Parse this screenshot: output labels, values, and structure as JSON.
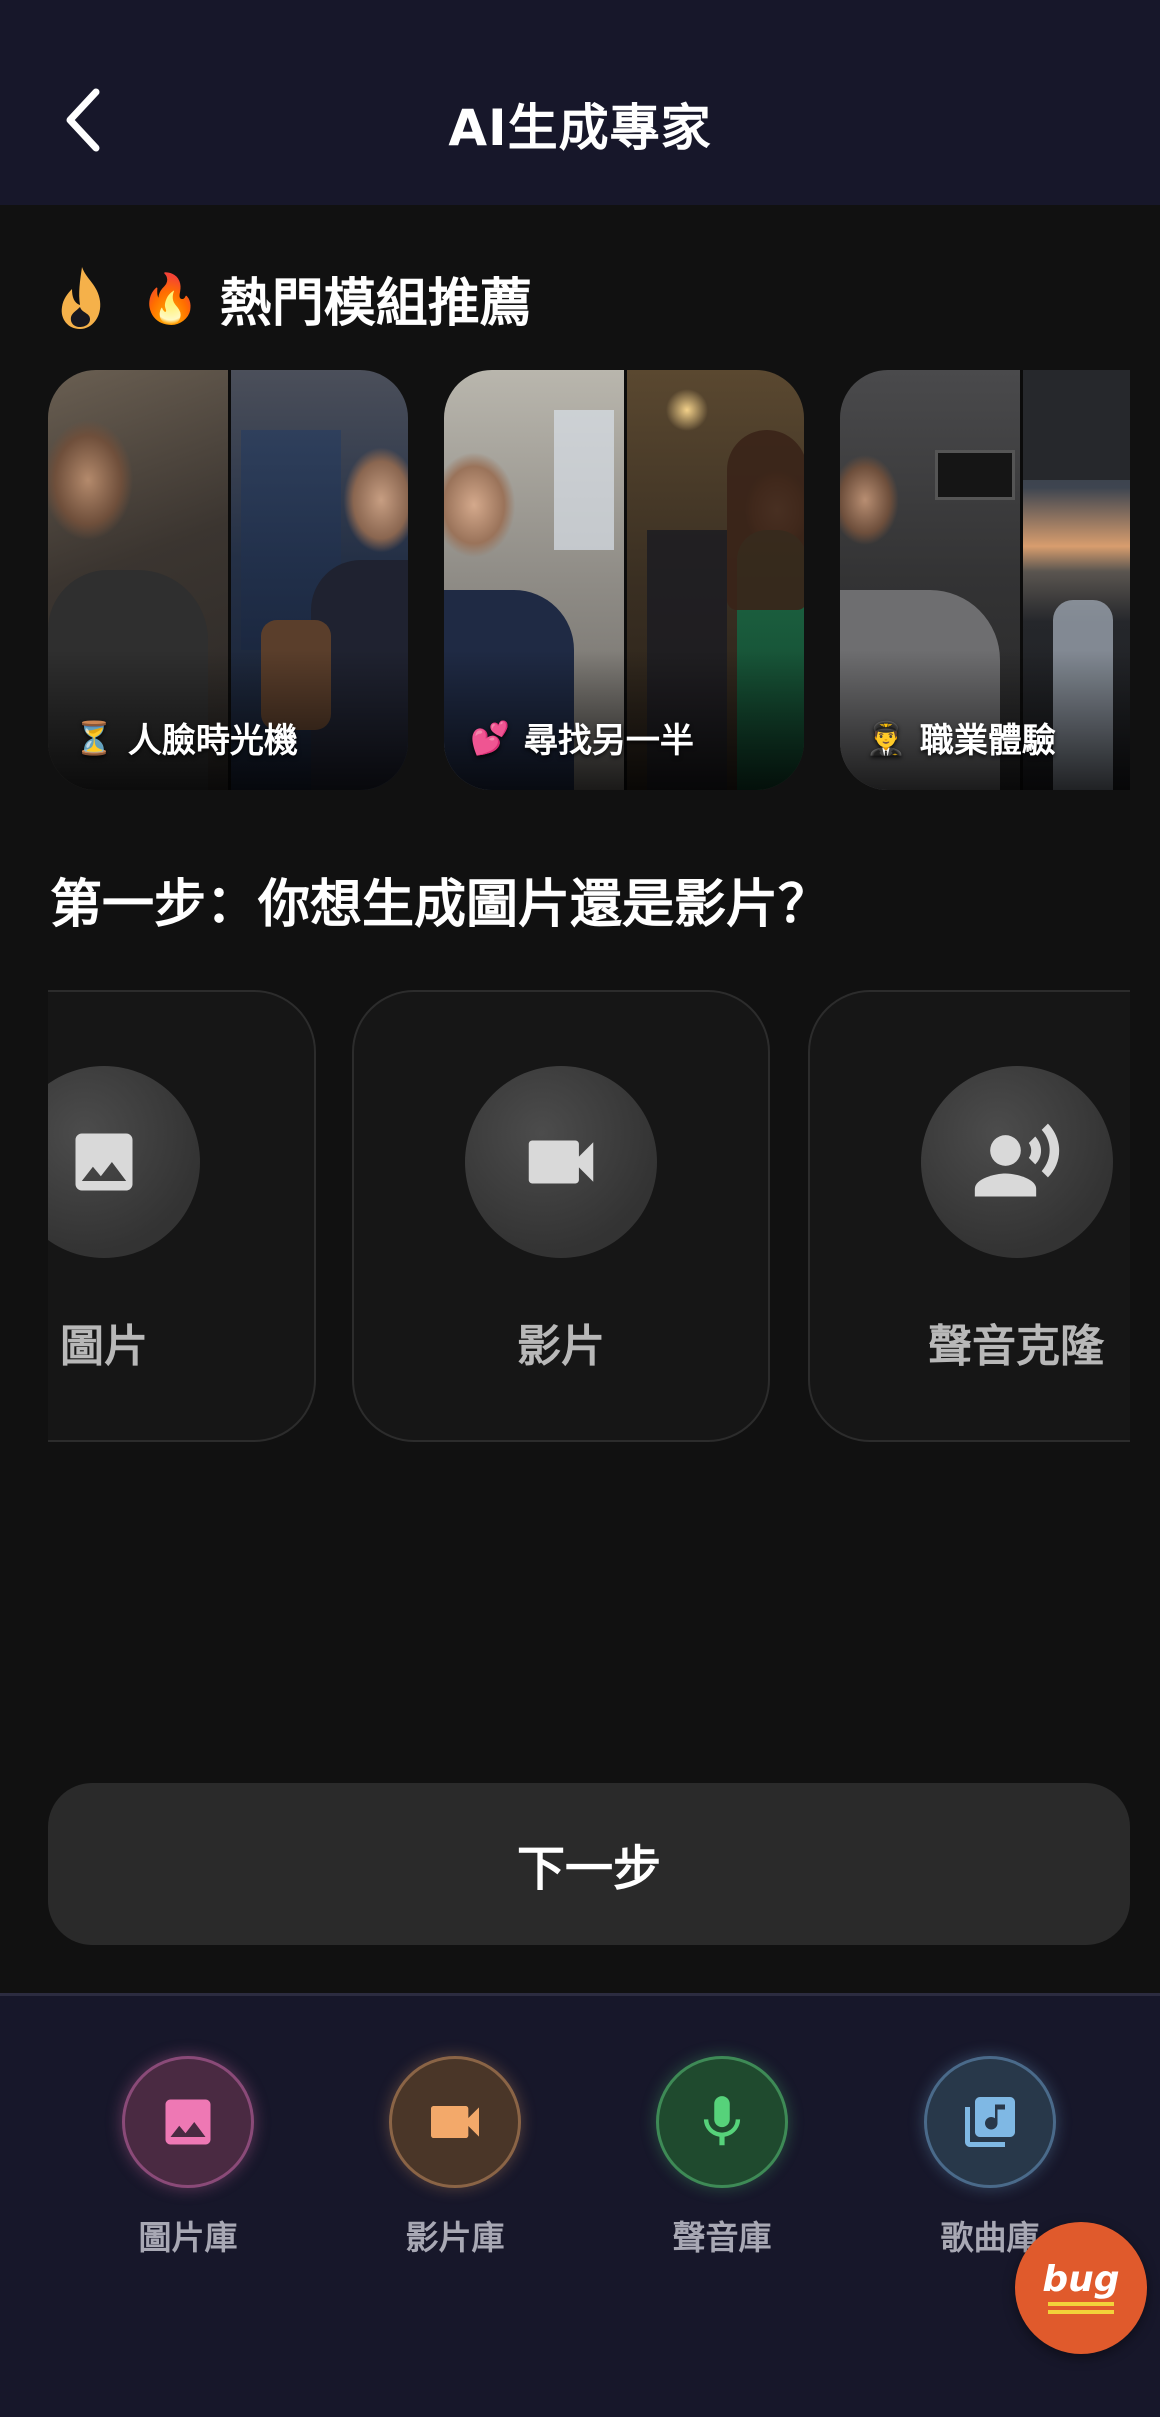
{
  "header": {
    "title": "AI生成專家"
  },
  "hot": {
    "emoji": "🔥",
    "title": "熱門模組推薦",
    "cards": [
      {
        "emoji": "⏳",
        "label": "人臉時光機"
      },
      {
        "emoji": "💕",
        "label": "尋找另一半"
      },
      {
        "emoji": "👨‍✈️",
        "label": "職業體驗"
      }
    ]
  },
  "step": {
    "title": "第一步：你想生成圖片還是影片？",
    "options": [
      {
        "label": "圖片",
        "icon": "image-icon"
      },
      {
        "label": "影片",
        "icon": "videocam-icon"
      },
      {
        "label": "聲音克隆",
        "icon": "voice-icon"
      }
    ]
  },
  "next_label": "下一步",
  "nav": {
    "items": [
      {
        "label": "圖片庫",
        "icon": "image-icon",
        "color": "#ee78b4"
      },
      {
        "label": "影片庫",
        "icon": "videocam-icon",
        "color": "#f3a96a"
      },
      {
        "label": "聲音庫",
        "icon": "mic-icon",
        "color": "#56d27a"
      },
      {
        "label": "歌曲庫",
        "icon": "music-library-icon",
        "color": "#7fb8e4"
      }
    ]
  },
  "bug_label": "bug"
}
